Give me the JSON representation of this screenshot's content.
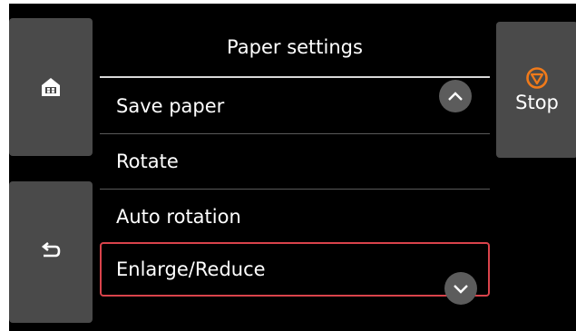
{
  "header": {
    "title": "Paper settings"
  },
  "sidebar": {
    "home_icon": "home-icon",
    "back_icon": "back-icon"
  },
  "stop": {
    "label": "Stop",
    "icon": "stop-icon",
    "icon_color": "#f07a1a"
  },
  "menu": {
    "items": [
      {
        "label": "Save paper"
      },
      {
        "label": "Rotate"
      },
      {
        "label": "Auto rotation"
      },
      {
        "label": "Enlarge/Reduce",
        "selected": true
      }
    ]
  },
  "scroll": {
    "up_icon": "chevron-up-icon",
    "down_icon": "chevron-down-icon"
  },
  "colors": {
    "background": "#000000",
    "button": "#4a4a4a",
    "selection": "#d9434b"
  }
}
